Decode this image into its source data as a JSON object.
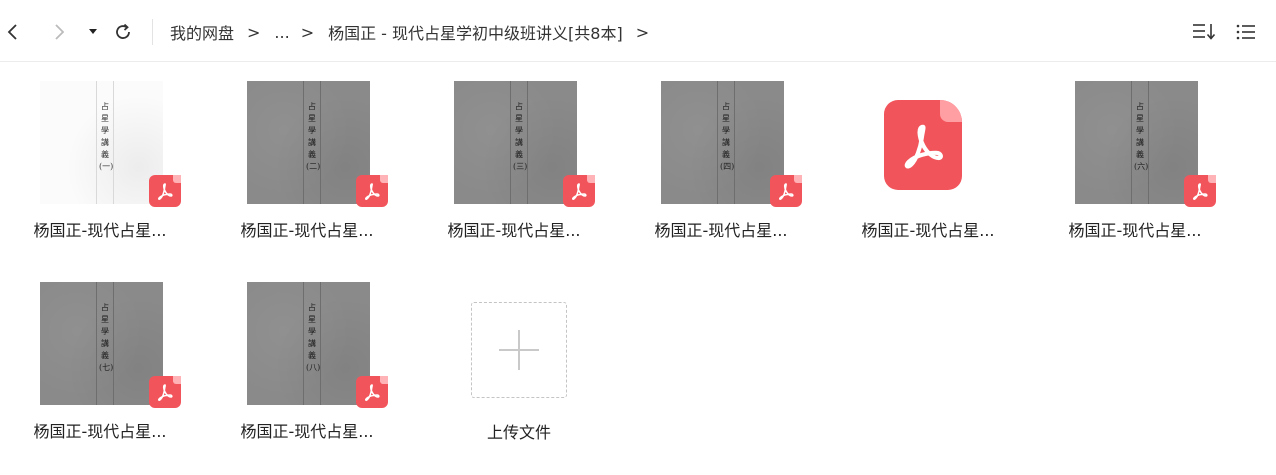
{
  "toolbar": {
    "back_icon": "chevron-left-icon",
    "forward_icon": "chevron-right-icon",
    "history_icon": "caret-down-icon",
    "refresh_icon": "refresh-icon",
    "sort_icon": "sort-icon",
    "list_view_icon": "list-view-icon"
  },
  "breadcrumb": {
    "items": [
      "我的网盘",
      "...",
      "杨国正 - 现代占星学初中级班讲义[共8本]"
    ],
    "separator": ">"
  },
  "files": [
    {
      "name": "杨国正-现代占星...",
      "thumb": "scan-light",
      "volume": "一"
    },
    {
      "name": "杨国正-现代占星...",
      "thumb": "scan",
      "volume": "二"
    },
    {
      "name": "杨国正-现代占星...",
      "thumb": "scan",
      "volume": "三"
    },
    {
      "name": "杨国正-现代占星...",
      "thumb": "scan",
      "volume": "四"
    },
    {
      "name": "杨国正-现代占星...",
      "thumb": "pdf-icon",
      "volume": ""
    },
    {
      "name": "杨国正-现代占星...",
      "thumb": "scan",
      "volume": "六"
    },
    {
      "name": "杨国正-现代占星...",
      "thumb": "scan",
      "volume": "七"
    },
    {
      "name": "杨国正-现代占星...",
      "thumb": "scan",
      "volume": "八"
    }
  ],
  "upload": {
    "label": "上传文件",
    "icon": "plus-icon"
  },
  "colors": {
    "pdf_red": "#f2545b",
    "icon_gray": "#333333",
    "disabled_gray": "#bbbbbb"
  }
}
